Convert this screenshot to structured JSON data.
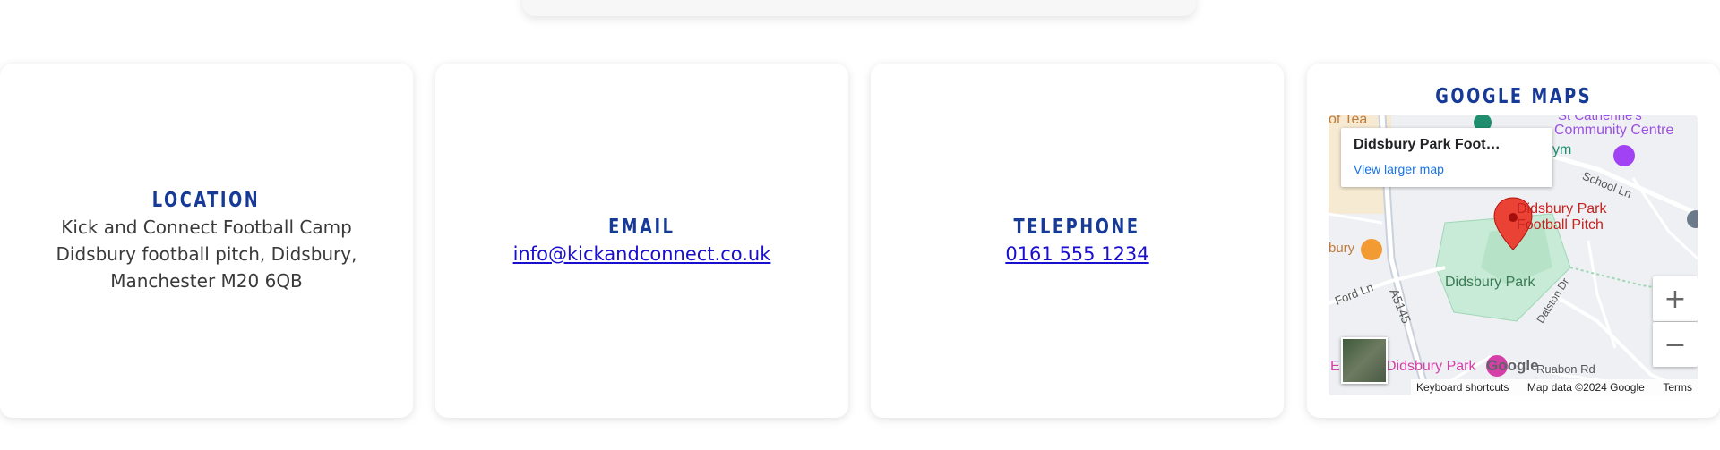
{
  "location": {
    "title": "LOCATION",
    "line1": "Kick and Connect Football Camp",
    "line2": "Didsbury football pitch, Didsbury,",
    "line3": "Manchester M20 6QB"
  },
  "email": {
    "title": "EMAIL",
    "address": "info@kickandconnect.co.uk"
  },
  "telephone": {
    "title": "TELEPHONE",
    "number": "0161 555 1234"
  },
  "map": {
    "title": "GOOGLE MAPS",
    "info_title": "Didsbury Park Foot…",
    "info_link": "View larger map",
    "zoom_in": "+",
    "zoom_out": "−",
    "marker_label_line1": "Didsbury Park",
    "marker_label_line2": "Football Pitch",
    "labels": {
      "tea": "of Tea",
      "community1": "St Catherine's",
      "community2": "Community Centre",
      "gym": "ym",
      "school_ln": "School Ln",
      "bury": "bury",
      "ford_ln": "Ford Ln",
      "a5145": "A5145",
      "park": "Didsbury Park",
      "dalston": "Dalston Dr",
      "e_park": "Didsbury Park",
      "e_prefix": "E",
      "ruabon": "Ruabon Rd",
      "google": "Google"
    },
    "footer": {
      "shortcuts": "Keyboard shortcuts",
      "data": "Map data ©2024 Google",
      "terms": "Terms"
    },
    "colors": {
      "park": "#c7ebd6",
      "marker": "#ea4335",
      "poi_purple": "#a142f4",
      "poi_orange": "#f29b33"
    }
  }
}
